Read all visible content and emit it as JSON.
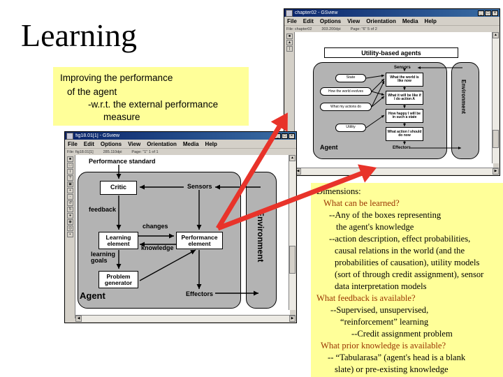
{
  "slide": {
    "title": "Learning",
    "background": "#ffffff",
    "highlight_color": "#ffff99",
    "arrow_color": "#e8332a",
    "heading_color": "#993300"
  },
  "callout_top": {
    "lines": [
      "Improving the performance",
      "of the agent",
      "-w.r.t. the external performance",
      "measure"
    ]
  },
  "callout_right": {
    "lines": [
      {
        "text": "Dimensions:",
        "style": "plain"
      },
      {
        "text": "What can be learned?",
        "style": "question"
      },
      {
        "text": "--Any of the boxes representing",
        "style": "plain"
      },
      {
        "text": "the agent's knowledge",
        "style": "plain"
      },
      {
        "text": "--action description, effect probabilities,",
        "style": "plain"
      },
      {
        "text": "causal relations in the world (and the",
        "style": "plain"
      },
      {
        "text": "probabilities of causation), utility models",
        "style": "plain"
      },
      {
        "text": "(sort of through credit assignment), sensor",
        "style": "plain"
      },
      {
        "text": "data interpretation models",
        "style": "plain"
      },
      {
        "text": "What feedback is available?",
        "style": "question"
      },
      {
        "text": "--Supervised, unsupervised,",
        "style": "plain"
      },
      {
        "text": "“reinforcement” learning",
        "style": "plain"
      },
      {
        "text": "--Credit assignment problem",
        "style": "plain"
      },
      {
        "text": "What prior knowledge is available?",
        "style": "question"
      },
      {
        "text": "-- “Tabularasa” (agent's head is a blank",
        "style": "plain"
      },
      {
        "text": "slate) or pre-existing knowledge",
        "style": "plain"
      }
    ]
  },
  "window_utility": {
    "title": "chapter02 - GSview",
    "menu": [
      "File",
      "Edit",
      "Options",
      "View",
      "Orientation",
      "Media",
      "Help"
    ],
    "status": [
      "File: chapter02",
      "303.200dpi",
      "Page: \"6\"  5 of  2"
    ],
    "titlebar_buttons": [
      "_",
      "□",
      "×"
    ],
    "toolbar_icons": [
      "print-icon",
      "open-icon",
      "info-icon"
    ],
    "diagram": {
      "banner": "Utility-based agents",
      "agent_label": "Agent",
      "environment_label": "Environment",
      "sensors_label": "Sensors",
      "effectors_label": "Effectors",
      "ovals": [
        "State",
        "How the world evolves",
        "What my actions do",
        "Utility"
      ],
      "boxes": [
        "What the world is like now",
        "What it will be like if I do action A",
        "How happy I will be in such a state",
        "What action I should do now"
      ]
    }
  },
  "window_learning": {
    "title": "fig18.01[1] - GSview",
    "menu": [
      "File",
      "Edit",
      "Options",
      "View",
      "Orientation",
      "Media",
      "Help"
    ],
    "status": [
      "File: fig18.01[1]",
      "285.110dpi",
      "Page: \"1\" 1 of 1"
    ],
    "titlebar_buttons": [
      "_",
      "□",
      "×"
    ],
    "toolbar_icons": [
      "print-icon",
      "open-icon",
      "info-icon",
      "help-icon",
      "select-icon",
      "zoom-in-icon",
      "zoom-out-icon",
      "rotate-icon",
      "page-icon",
      "ghost-icon",
      "ghost2-icon",
      "ghost3-icon",
      "ghost4-icon"
    ],
    "diagram": {
      "performance_standard": "Performance standard",
      "critic": "Critic",
      "sensors": "Sensors",
      "feedback": "feedback",
      "changes": "changes",
      "learning_element": "Learning element",
      "performance_element": "Performance element",
      "knowledge": "knowledge",
      "learning_goals": "learning goals",
      "problem_generator": "Problem generator",
      "agent_label": "Agent",
      "effectors": "Effectors",
      "environment_label": "Environment"
    }
  }
}
